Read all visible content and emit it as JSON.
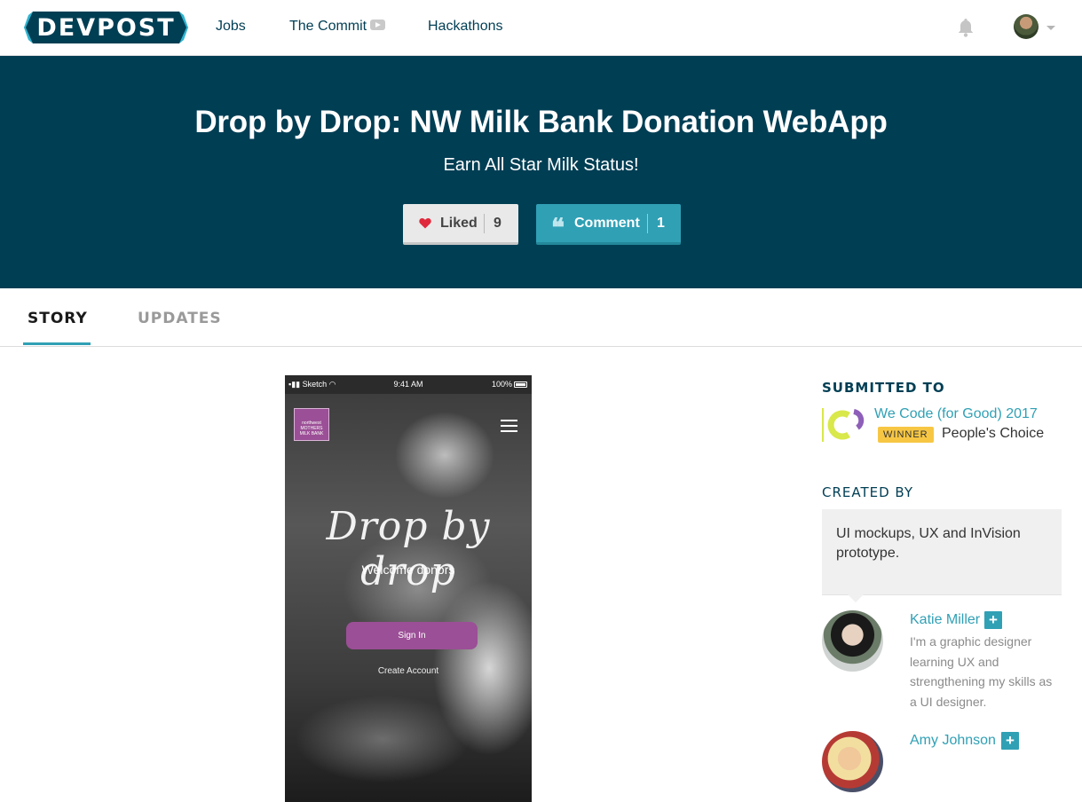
{
  "nav": {
    "logo": "DEVPOST",
    "links": [
      "Jobs",
      "The Commit",
      "Hackathons"
    ],
    "commit_icon": "youtube-icon",
    "bell_icon": "bell-icon",
    "avatar_icon": "user-avatar",
    "caret_icon": "caret-down-icon"
  },
  "hero": {
    "title": "Drop by Drop: NW Milk Bank Donation WebApp",
    "subtitle": "Earn All Star Milk Status!",
    "like": {
      "label": "Liked",
      "count": "9",
      "icon": "heart-icon"
    },
    "comment": {
      "label": "Comment",
      "count": "1",
      "icon": "quote-icon"
    }
  },
  "tabs": [
    {
      "label": "STORY",
      "active": true
    },
    {
      "label": "UPDATES",
      "active": false
    }
  ],
  "phone": {
    "status_left": "Sketch",
    "status_time": "9:41 AM",
    "status_battery": "100%",
    "logo_text": "northwest MOTHERS MILK BANK",
    "script_title": "Drop by drop",
    "welcome": "Welcome donors",
    "signin": "Sign In",
    "create_account": "Create Account"
  },
  "sidebar": {
    "submitted_heading": "SUBMITTED TO",
    "event": "We Code (for Good) 2017",
    "winner_badge": "WINNER",
    "prize": "People's Choice",
    "created_heading": "CREATED BY",
    "contribution": "UI mockups, UX and InVision prototype.",
    "members": [
      {
        "name": "Katie Miller",
        "bio": "I'm a graphic designer learning UX and strengthening my skills as a UI designer."
      },
      {
        "name": "Amy Johnson",
        "bio": ""
      }
    ],
    "follow_label": "+"
  },
  "colors": {
    "brand_dark": "#003e54",
    "accent": "#30a0b5",
    "winner": "#f7c744",
    "phone_purple": "#9b4f96"
  }
}
